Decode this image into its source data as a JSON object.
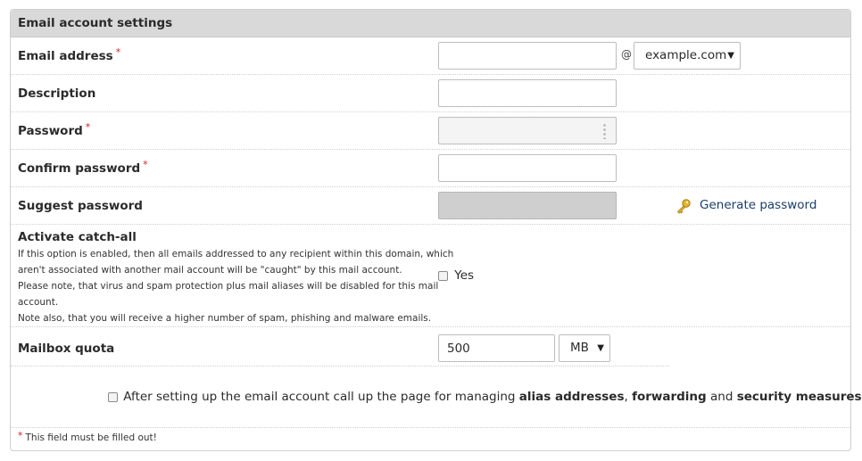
{
  "header": {
    "title": "Email account settings"
  },
  "required_marker": "*",
  "fields": {
    "email": {
      "label": "Email address",
      "value": "",
      "at_sign": "@",
      "domain": "example.com"
    },
    "description": {
      "label": "Description",
      "value": ""
    },
    "password": {
      "label": "Password",
      "value": ""
    },
    "confirm_password": {
      "label": "Confirm password",
      "value": ""
    },
    "suggest_password": {
      "label": "Suggest password",
      "value": "",
      "link_label": "Generate password",
      "icon": "key-icon"
    },
    "catch_all": {
      "label": "Activate catch-all",
      "help_lines": [
        "If this option is enabled, then all emails addressed to any recipient within this domain, which",
        "aren't associated with another mail account will be \"caught\" by this mail account.",
        "Please note, that virus and spam protection plus mail aliases will be disabled for this mail",
        "account.",
        "Note also, that you will receive a higher number of spam, phishing and malware emails."
      ],
      "checkbox_label": "Yes",
      "checked": false
    },
    "quota": {
      "label": "Mailbox quota",
      "value": "500",
      "unit": "MB"
    }
  },
  "after_setup": {
    "checked": false,
    "text_prefix": "After setting up the email account call up the page for managing ",
    "bold_1": "alias addresses",
    "sep_1": ", ",
    "bold_2": "forwarding",
    "sep_2": " and ",
    "bold_3": "security measures"
  },
  "footer": {
    "note": "This field must be filled out!"
  },
  "colors": {
    "required": "#d42020",
    "link": "#1a3d6b",
    "header_bg": "#d9d9d9"
  }
}
